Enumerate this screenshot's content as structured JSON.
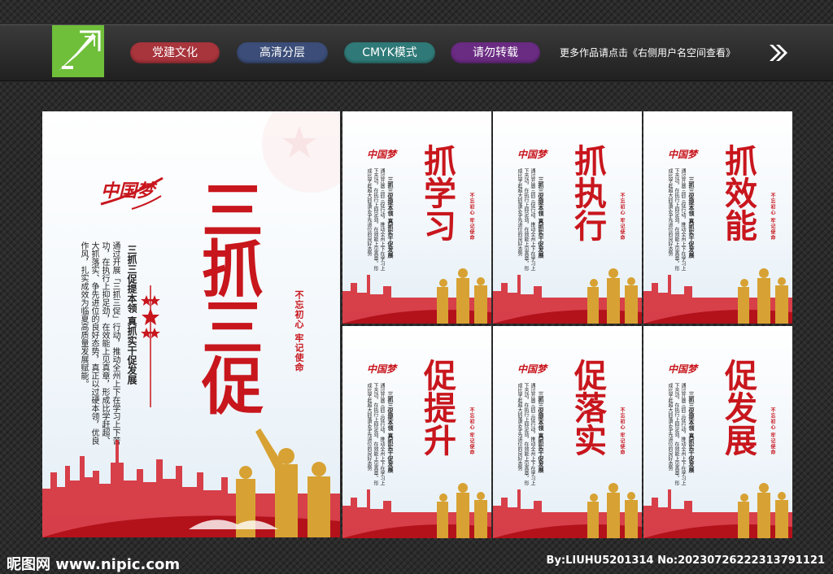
{
  "tags": [
    {
      "label": "党建文化",
      "color": "#a8343c"
    },
    {
      "label": "高清分层",
      "color": "#3b4d78"
    },
    {
      "label": "CMYK模式",
      "color": "#2f7a78"
    },
    {
      "label": "请勿转载",
      "color": "#6a2b82"
    }
  ],
  "more_note": "更多作品请点击《右侧用户名空间查看》",
  "main_poster": {
    "title": "三抓三促",
    "subtitle": "三抓三促提本领 真抓实干促发展",
    "body": "通过开展「三抓三促」行动，推动全州上下在学习上下苦功，在执行上抑足劲，在效能上见真章，形成比学赶超、大抓落实、争先进位的良好态势，真正以过硬本领，优良作风，扎实成效为临夏高质量发展赋能。",
    "seal": "不忘初心 牢记使命",
    "logo": "中国梦"
  },
  "posters": [
    {
      "title": "抓学习"
    },
    {
      "title": "抓执行"
    },
    {
      "title": "抓效能"
    },
    {
      "title": "促提升"
    },
    {
      "title": "促落实"
    },
    {
      "title": "促发展"
    }
  ],
  "small_subtitle": "三抓三促提本领 真抓实干促发展",
  "small_body": "通过开展三抓三促行动，推动全州上下在学习上下苦功，在执行上抑足劲，在效能上见真章，形成比学赶超大抓落实争先进位的良好态势",
  "small_seal": "不忘初心 牢记使命",
  "small_logo": "中国梦",
  "site": "昵图网 www.nipic.com",
  "credit": "By:LIUHU5201314 No:20230726222313791121"
}
